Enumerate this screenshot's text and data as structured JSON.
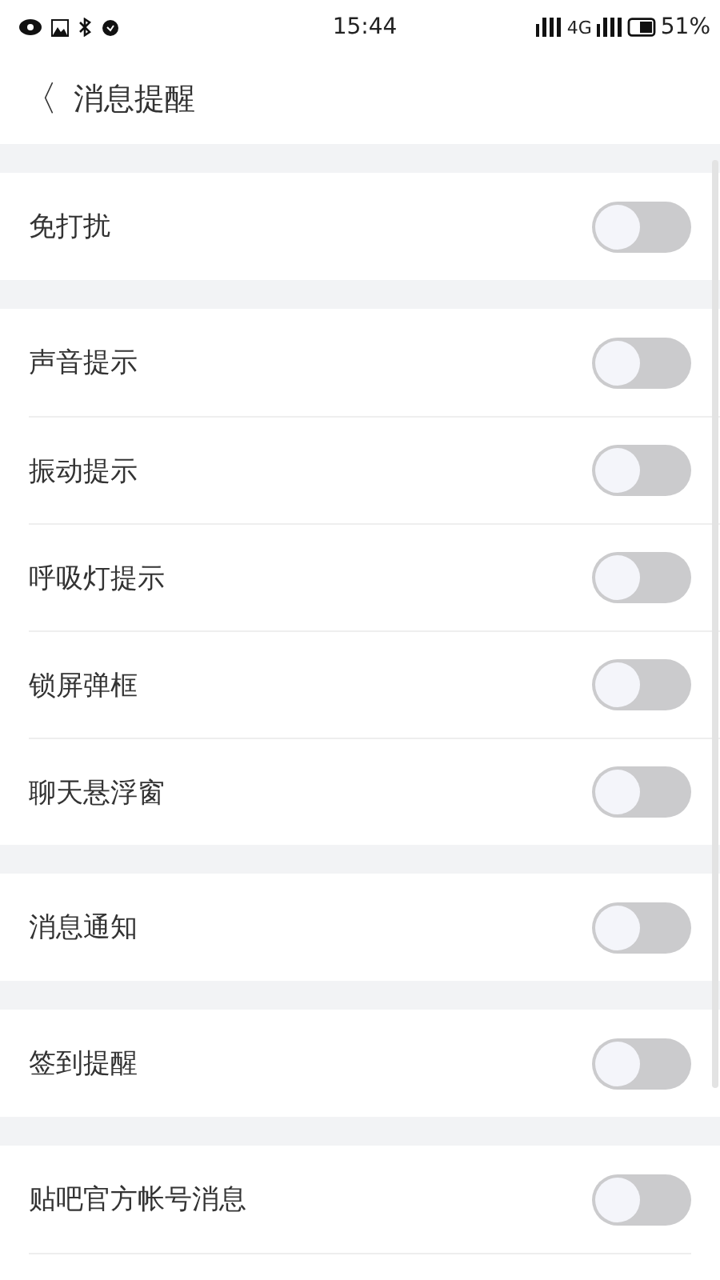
{
  "status_bar": {
    "time": "15:44",
    "network": "4G",
    "battery": "51%"
  },
  "header": {
    "back": "〈",
    "title": "消息提醒"
  },
  "sections": [
    {
      "items": [
        {
          "label": "免打扰",
          "on": false
        }
      ]
    },
    {
      "items": [
        {
          "label": "声音提示",
          "on": false
        },
        {
          "label": "振动提示",
          "on": false
        },
        {
          "label": "呼吸灯提示",
          "on": false
        },
        {
          "label": "锁屏弹框",
          "on": false
        },
        {
          "label": "聊天悬浮窗",
          "on": false
        }
      ]
    },
    {
      "items": [
        {
          "label": "消息通知",
          "on": false
        }
      ]
    },
    {
      "items": [
        {
          "label": "签到提醒",
          "on": false
        }
      ]
    },
    {
      "items": [
        {
          "label": "贴吧官方帐号消息",
          "on": false
        }
      ]
    }
  ]
}
